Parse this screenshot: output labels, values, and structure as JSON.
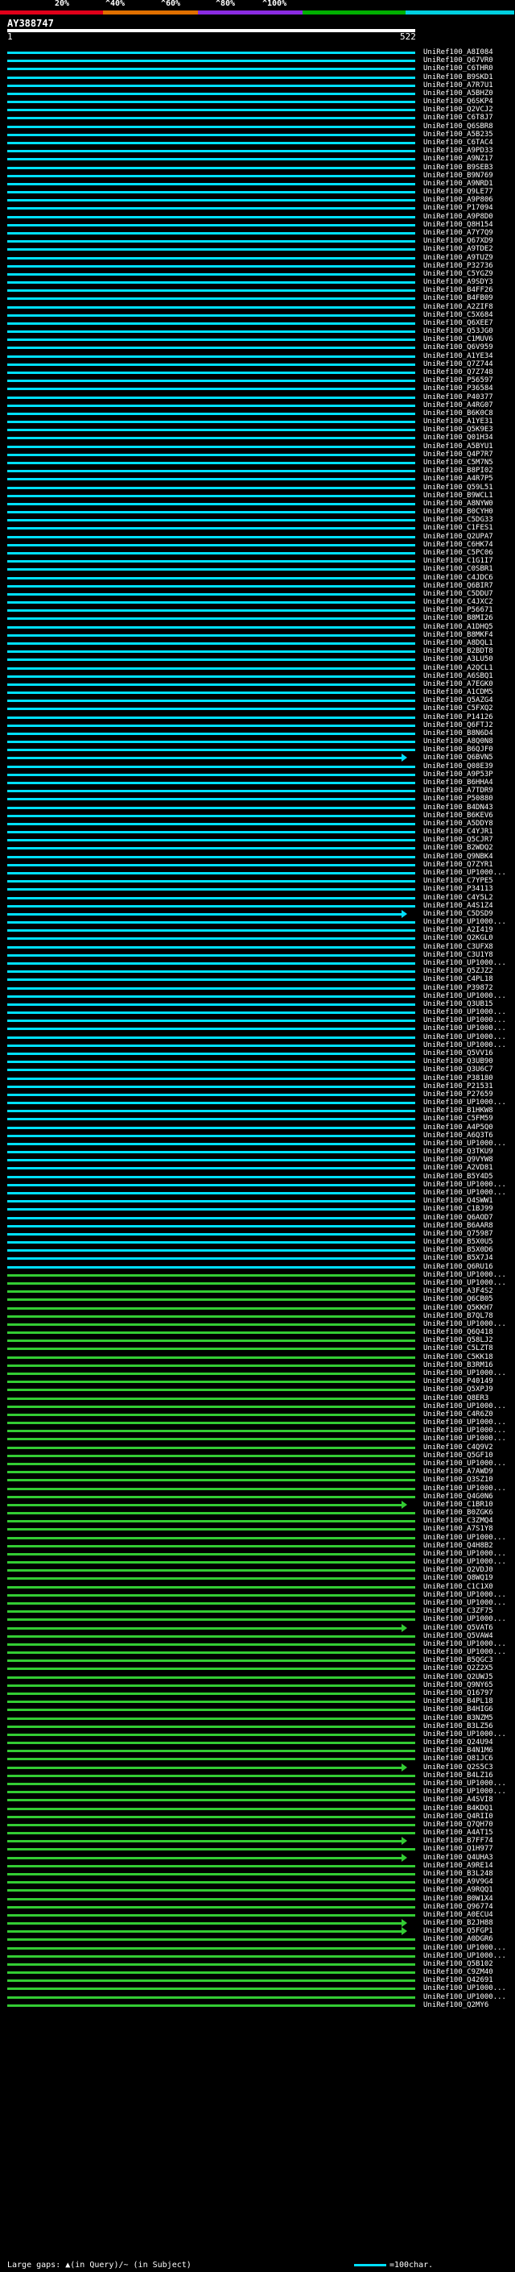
{
  "scale": {
    "labels": [
      "20%",
      "^40%",
      "^60%",
      "^80%",
      "^100%"
    ],
    "colors": [
      "#e0001a",
      "#e07000",
      "#8a2be2",
      "#00b000",
      "#00d0e0"
    ]
  },
  "query": {
    "name": "AY388747",
    "start": "1",
    "end": "522"
  },
  "hits": [
    {
      "name": "UniRef100_A8I084",
      "color": "#00e0ff"
    },
    {
      "name": "UniRef100_Q67VR0",
      "color": "#00e0ff"
    },
    {
      "name": "UniRef100_C6THR0",
      "color": "#00e0ff"
    },
    {
      "name": "UniRef100_B9SKD1",
      "color": "#00e0ff"
    },
    {
      "name": "UniRef100_A7R7U1",
      "color": "#00e0ff"
    },
    {
      "name": "UniRef100_A5BHZ0",
      "color": "#00e0ff"
    },
    {
      "name": "UniRef100_Q6SKP4",
      "color": "#00e0ff"
    },
    {
      "name": "UniRef100_Q2VCJ2",
      "color": "#00e0ff"
    },
    {
      "name": "UniRef100_C6T8J7",
      "color": "#00e0ff"
    },
    {
      "name": "UniRef100_Q6SBR8",
      "color": "#00e0ff"
    },
    {
      "name": "UniRef100_A5B235",
      "color": "#00e0ff"
    },
    {
      "name": "UniRef100_C6TAC4",
      "color": "#00e0ff"
    },
    {
      "name": "UniRef100_A9PD33",
      "color": "#00e0ff"
    },
    {
      "name": "UniRef100_A9NZ17",
      "color": "#00e0ff"
    },
    {
      "name": "UniRef100_B9SEB3",
      "color": "#00e0ff"
    },
    {
      "name": "UniRef100_B9N769",
      "color": "#00e0ff"
    },
    {
      "name": "UniRef100_A9NRD1",
      "color": "#00e0ff"
    },
    {
      "name": "UniRef100_Q9LE77",
      "color": "#00e0ff"
    },
    {
      "name": "UniRef100_A9P806",
      "color": "#00e0ff"
    },
    {
      "name": "UniRef100_P17094",
      "color": "#00e0ff"
    },
    {
      "name": "UniRef100_A9P8D0",
      "color": "#00e0ff"
    },
    {
      "name": "UniRef100_Q8H154",
      "color": "#00e0ff"
    },
    {
      "name": "UniRef100_A7Y7Q9",
      "color": "#00e0ff"
    },
    {
      "name": "UniRef100_Q67XD9",
      "color": "#00e0ff"
    },
    {
      "name": "UniRef100_A9TDE2",
      "color": "#00e0ff"
    },
    {
      "name": "UniRef100_A9TUZ9",
      "color": "#00e0ff"
    },
    {
      "name": "UniRef100_P32736",
      "color": "#00e0ff"
    },
    {
      "name": "UniRef100_C5YGZ9",
      "color": "#00e0ff"
    },
    {
      "name": "UniRef100_A9SDY3",
      "color": "#00e0ff"
    },
    {
      "name": "UniRef100_B4FF26",
      "color": "#00e0ff"
    },
    {
      "name": "UniRef100_B4FB09",
      "color": "#00e0ff"
    },
    {
      "name": "UniRef100_A2ZIF8",
      "color": "#00e0ff"
    },
    {
      "name": "UniRef100_C5X684",
      "color": "#00e0ff"
    },
    {
      "name": "UniRef100_Q6XEE7",
      "color": "#00e0ff"
    },
    {
      "name": "UniRef100_Q53JG0",
      "color": "#00e0ff"
    },
    {
      "name": "UniRef100_C1MUV6",
      "color": "#00e0ff"
    },
    {
      "name": "UniRef100_Q6V959",
      "color": "#00e0ff"
    },
    {
      "name": "UniRef100_A1YE34",
      "color": "#00e0ff"
    },
    {
      "name": "UniRef100_Q7Z744",
      "color": "#00e0ff"
    },
    {
      "name": "UniRef100_Q7Z748",
      "color": "#00e0ff"
    },
    {
      "name": "UniRef100_P56597",
      "color": "#00e0ff"
    },
    {
      "name": "UniRef100_P36584",
      "color": "#00e0ff"
    },
    {
      "name": "UniRef100_P40377",
      "color": "#00e0ff"
    },
    {
      "name": "UniRef100_A4RG07",
      "color": "#00e0ff"
    },
    {
      "name": "UniRef100_B6K0C8",
      "color": "#00e0ff"
    },
    {
      "name": "UniRef100_A1YE31",
      "color": "#00e0ff"
    },
    {
      "name": "UniRef100_Q5K9E3",
      "color": "#00e0ff"
    },
    {
      "name": "UniRef100_Q01H34",
      "color": "#00e0ff"
    },
    {
      "name": "UniRef100_A5BYU1",
      "color": "#00e0ff"
    },
    {
      "name": "UniRef100_Q4P7R7",
      "color": "#00e0ff"
    },
    {
      "name": "UniRef100_C5M7N5",
      "color": "#00e0ff"
    },
    {
      "name": "UniRef100_B8PI02",
      "color": "#00e0ff"
    },
    {
      "name": "UniRef100_A4R7P5",
      "color": "#00e0ff"
    },
    {
      "name": "UniRef100_Q59L51",
      "color": "#00e0ff"
    },
    {
      "name": "UniRef100_B9WCL1",
      "color": "#00e0ff"
    },
    {
      "name": "UniRef100_A8NYW0",
      "color": "#00e0ff"
    },
    {
      "name": "UniRef100_B0CYH0",
      "color": "#00e0ff"
    },
    {
      "name": "UniRef100_C5DG33",
      "color": "#00e0ff"
    },
    {
      "name": "UniRef100_C1FES1",
      "color": "#00e0ff"
    },
    {
      "name": "UniRef100_Q2UPA7",
      "color": "#00e0ff"
    },
    {
      "name": "UniRef100_C6HK74",
      "color": "#00e0ff"
    },
    {
      "name": "UniRef100_C5PC06",
      "color": "#00e0ff"
    },
    {
      "name": "UniRef100_C1G1I7",
      "color": "#00e0ff"
    },
    {
      "name": "UniRef100_C0SBR1",
      "color": "#00e0ff"
    },
    {
      "name": "UniRef100_C4JDC6",
      "color": "#00e0ff"
    },
    {
      "name": "UniRef100_Q6BIR7",
      "color": "#00e0ff"
    },
    {
      "name": "UniRef100_C5DDU7",
      "color": "#00e0ff"
    },
    {
      "name": "UniRef100_C4JXC2",
      "color": "#00e0ff"
    },
    {
      "name": "UniRef100_P56671",
      "color": "#00e0ff"
    },
    {
      "name": "UniRef100_B8MI26",
      "color": "#00e0ff"
    },
    {
      "name": "UniRef100_A1DHQ5",
      "color": "#00e0ff"
    },
    {
      "name": "UniRef100_B8MKF4",
      "color": "#00e0ff"
    },
    {
      "name": "UniRef100_A8DQL1",
      "color": "#00e0ff"
    },
    {
      "name": "UniRef100_B2BDT8",
      "color": "#00e0ff"
    },
    {
      "name": "UniRef100_A3LU50",
      "color": "#00e0ff"
    },
    {
      "name": "UniRef100_A2QCL1",
      "color": "#00e0ff"
    },
    {
      "name": "UniRef100_A6SBQ1",
      "color": "#00e0ff"
    },
    {
      "name": "UniRef100_A7EGK0",
      "color": "#00e0ff"
    },
    {
      "name": "UniRef100_A1CDM5",
      "color": "#00e0ff"
    },
    {
      "name": "UniRef100_Q5AZG4",
      "color": "#00e0ff"
    },
    {
      "name": "UniRef100_C5FXQ2",
      "color": "#00e0ff"
    },
    {
      "name": "UniRef100_P14126",
      "color": "#00e0ff"
    },
    {
      "name": "UniRef100_Q6FTJ2",
      "color": "#00e0ff"
    },
    {
      "name": "UniRef100_B8N6D4",
      "color": "#00e0ff"
    },
    {
      "name": "UniRef100_A8Q0N8",
      "color": "#00e0ff"
    },
    {
      "name": "UniRef100_B6QJF0",
      "color": "#00e0ff"
    },
    {
      "name": "UniRef100_Q6BVN5",
      "color": "#00e0ff",
      "arrow": true
    },
    {
      "name": "UniRef100_Q08E39",
      "color": "#00e0ff"
    },
    {
      "name": "UniRef100_A9P53P",
      "color": "#00e0ff"
    },
    {
      "name": "UniRef100_B6HHA4",
      "color": "#00e0ff"
    },
    {
      "name": "UniRef100_A7TDR9",
      "color": "#00e0ff"
    },
    {
      "name": "UniRef100_P50880",
      "color": "#00e0ff"
    },
    {
      "name": "UniRef100_B4DN43",
      "color": "#00e0ff"
    },
    {
      "name": "UniRef100_B6KEV6",
      "color": "#00e0ff"
    },
    {
      "name": "UniRef100_A5DDY8",
      "color": "#00e0ff"
    },
    {
      "name": "UniRef100_C4YJR1",
      "color": "#00e0ff"
    },
    {
      "name": "UniRef100_Q5CJR7",
      "color": "#00e0ff"
    },
    {
      "name": "UniRef100_B2WDQ2",
      "color": "#00e0ff"
    },
    {
      "name": "UniRef100_Q9NBK4",
      "color": "#00e0ff"
    },
    {
      "name": "UniRef100_Q7ZYR1",
      "color": "#00e0ff"
    },
    {
      "name": "UniRef100_UP1000...",
      "color": "#00e0ff"
    },
    {
      "name": "UniRef100_C7YPE5",
      "color": "#00e0ff"
    },
    {
      "name": "UniRef100_P34113",
      "color": "#00e0ff"
    },
    {
      "name": "UniRef100_C4Y5L2",
      "color": "#00e0ff"
    },
    {
      "name": "UniRef100_A4S1Z4",
      "color": "#00e0ff"
    },
    {
      "name": "UniRef100_C5DSD9",
      "color": "#00e0ff",
      "arrow": true
    },
    {
      "name": "UniRef100_UP1000...",
      "color": "#00e0ff"
    },
    {
      "name": "UniRef100_A2I419",
      "color": "#00e0ff"
    },
    {
      "name": "UniRef100_Q2KGL0",
      "color": "#00e0ff"
    },
    {
      "name": "UniRef100_C3UFX8",
      "color": "#00e0ff"
    },
    {
      "name": "UniRef100_C3U1Y8",
      "color": "#00e0ff"
    },
    {
      "name": "UniRef100_UP1000...",
      "color": "#00e0ff"
    },
    {
      "name": "UniRef100_Q5ZJZ2",
      "color": "#00e0ff"
    },
    {
      "name": "UniRef100_C4PL18",
      "color": "#00e0ff"
    },
    {
      "name": "UniRef100_P39872",
      "color": "#00e0ff"
    },
    {
      "name": "UniRef100_UP1000...",
      "color": "#00e0ff"
    },
    {
      "name": "UniRef100_Q3UB15",
      "color": "#00e0ff"
    },
    {
      "name": "UniRef100_UP1000...",
      "color": "#00e0ff"
    },
    {
      "name": "UniRef100_UP1000...",
      "color": "#00e0ff"
    },
    {
      "name": "UniRef100_UP1000...",
      "color": "#00e0ff"
    },
    {
      "name": "UniRef100_UP1000...",
      "color": "#00e0ff"
    },
    {
      "name": "UniRef100_UP1000...",
      "color": "#00e0ff"
    },
    {
      "name": "UniRef100_Q5VV16",
      "color": "#00e0ff"
    },
    {
      "name": "UniRef100_Q3UB90",
      "color": "#00e0ff"
    },
    {
      "name": "UniRef100_Q3U6C7",
      "color": "#00e0ff"
    },
    {
      "name": "UniRef100_P38180",
      "color": "#00e0ff"
    },
    {
      "name": "UniRef100_P21531",
      "color": "#00e0ff"
    },
    {
      "name": "UniRef100_P27659",
      "color": "#00e0ff"
    },
    {
      "name": "UniRef100_UP1000...",
      "color": "#00e0ff"
    },
    {
      "name": "UniRef100_B1HKW8",
      "color": "#00e0ff"
    },
    {
      "name": "UniRef100_C5FM59",
      "color": "#00e0ff"
    },
    {
      "name": "UniRef100_A4P5Q0",
      "color": "#00e0ff"
    },
    {
      "name": "UniRef100_A6Q3T6",
      "color": "#00e0ff"
    },
    {
      "name": "UniRef100_UP1000...",
      "color": "#00e0ff"
    },
    {
      "name": "UniRef100_Q3TKU9",
      "color": "#00e0ff"
    },
    {
      "name": "UniRef100_Q9VYW8",
      "color": "#00e0ff"
    },
    {
      "name": "UniRef100_A2VD81",
      "color": "#00e0ff"
    },
    {
      "name": "UniRef100_B5Y4D5",
      "color": "#00e0ff"
    },
    {
      "name": "UniRef100_UP1000...",
      "color": "#00e0ff"
    },
    {
      "name": "UniRef100_UP1000...",
      "color": "#00e0ff"
    },
    {
      "name": "UniRef100_Q4SWW1",
      "color": "#00e0ff"
    },
    {
      "name": "UniRef100_C1BJ99",
      "color": "#00e0ff"
    },
    {
      "name": "UniRef100_Q6AOD7",
      "color": "#00e0ff"
    },
    {
      "name": "UniRef100_B6AAR8",
      "color": "#00e0ff"
    },
    {
      "name": "UniRef100_Q75987",
      "color": "#00e0ff"
    },
    {
      "name": "UniRef100_B5X0U5",
      "color": "#00e0ff"
    },
    {
      "name": "UniRef100_B5X0D6",
      "color": "#00e0ff"
    },
    {
      "name": "UniRef100_B5X7J4",
      "color": "#00e0ff"
    },
    {
      "name": "UniRef100_Q6RU16",
      "color": "#00e0ff"
    },
    {
      "name": "UniRef100_UP1000...",
      "color": "#33cc33"
    },
    {
      "name": "UniRef100_UP1000...",
      "color": "#33cc33"
    },
    {
      "name": "UniRef100_A3F4S2",
      "color": "#33cc33"
    },
    {
      "name": "UniRef100_Q6CB05",
      "color": "#33cc33"
    },
    {
      "name": "UniRef100_Q5KKH7",
      "color": "#33cc33"
    },
    {
      "name": "UniRef100_B7QL78",
      "color": "#33cc33"
    },
    {
      "name": "UniRef100_UP1000...",
      "color": "#33cc33"
    },
    {
      "name": "UniRef100_Q6Q418",
      "color": "#33cc33"
    },
    {
      "name": "UniRef100_Q58LJ2",
      "color": "#33cc33"
    },
    {
      "name": "UniRef100_C5LZT8",
      "color": "#33cc33"
    },
    {
      "name": "UniRef100_C5KK18",
      "color": "#33cc33"
    },
    {
      "name": "UniRef100_B3RM16",
      "color": "#33cc33"
    },
    {
      "name": "UniRef100_UP1000...",
      "color": "#33cc33"
    },
    {
      "name": "UniRef100_P40149",
      "color": "#33cc33"
    },
    {
      "name": "UniRef100_Q5XPJ9",
      "color": "#33cc33"
    },
    {
      "name": "UniRef100_Q8ER3",
      "color": "#33cc33"
    },
    {
      "name": "UniRef100_UP1000...",
      "color": "#33cc33"
    },
    {
      "name": "UniRef100_C4R6Z0",
      "color": "#33cc33"
    },
    {
      "name": "UniRef100_UP1000...",
      "color": "#33cc33"
    },
    {
      "name": "UniRef100_UP1000...",
      "color": "#33cc33"
    },
    {
      "name": "UniRef100_UP1000...",
      "color": "#33cc33"
    },
    {
      "name": "UniRef100_C4Q9V2",
      "color": "#33cc33"
    },
    {
      "name": "UniRef100_Q5GF10",
      "color": "#33cc33"
    },
    {
      "name": "UniRef100_UP1000...",
      "color": "#33cc33"
    },
    {
      "name": "UniRef100_A7AWD9",
      "color": "#33cc33"
    },
    {
      "name": "UniRef100_Q3SZ10",
      "color": "#33cc33"
    },
    {
      "name": "UniRef100_UP1000...",
      "color": "#33cc33"
    },
    {
      "name": "UniRef100_Q4G0N6",
      "color": "#33cc33"
    },
    {
      "name": "UniRef100_C1BR10",
      "color": "#33cc33",
      "arrow": true
    },
    {
      "name": "UniRef100_B0ZGK6",
      "color": "#33cc33"
    },
    {
      "name": "UniRef100_C3ZMQ4",
      "color": "#33cc33"
    },
    {
      "name": "UniRef100_A7S1Y8",
      "color": "#33cc33"
    },
    {
      "name": "UniRef100_UP1000...",
      "color": "#33cc33"
    },
    {
      "name": "UniRef100_Q4H8B2",
      "color": "#33cc33"
    },
    {
      "name": "UniRef100_UP1000...",
      "color": "#33cc33"
    },
    {
      "name": "UniRef100_UP1000...",
      "color": "#33cc33"
    },
    {
      "name": "UniRef100_Q2VDJ0",
      "color": "#33cc33"
    },
    {
      "name": "UniRef100_Q8WQ19",
      "color": "#33cc33"
    },
    {
      "name": "UniRef100_C1C1X0",
      "color": "#33cc33"
    },
    {
      "name": "UniRef100_UP1000...",
      "color": "#33cc33"
    },
    {
      "name": "UniRef100_UP1000...",
      "color": "#33cc33"
    },
    {
      "name": "UniRef100_C3ZF75",
      "color": "#33cc33"
    },
    {
      "name": "UniRef100_UP1000...",
      "color": "#33cc33"
    },
    {
      "name": "UniRef100_Q5VAT6",
      "color": "#33cc33",
      "arrow": true
    },
    {
      "name": "UniRef100_Q5VAW4",
      "color": "#33cc33"
    },
    {
      "name": "UniRef100_UP1000...",
      "color": "#33cc33"
    },
    {
      "name": "UniRef100_UP1000...",
      "color": "#33cc33"
    },
    {
      "name": "UniRef100_B5QGC3",
      "color": "#33cc33"
    },
    {
      "name": "UniRef100_Q2Z2X5",
      "color": "#33cc33"
    },
    {
      "name": "UniRef100_Q2UWJ5",
      "color": "#33cc33"
    },
    {
      "name": "UniRef100_Q9NY65",
      "color": "#33cc33"
    },
    {
      "name": "UniRef100_Q16797",
      "color": "#33cc33"
    },
    {
      "name": "UniRef100_B4PL18",
      "color": "#33cc33"
    },
    {
      "name": "UniRef100_B4HIG6",
      "color": "#33cc33"
    },
    {
      "name": "UniRef100_B3NZM5",
      "color": "#33cc33"
    },
    {
      "name": "UniRef100_B3LZ56",
      "color": "#33cc33"
    },
    {
      "name": "UniRef100_UP1000...",
      "color": "#33cc33"
    },
    {
      "name": "UniRef100_Q24U94",
      "color": "#33cc33"
    },
    {
      "name": "UniRef100_B4N1M6",
      "color": "#33cc33"
    },
    {
      "name": "UniRef100_Q81JC6",
      "color": "#33cc33"
    },
    {
      "name": "UniRef100_Q2S5C3",
      "color": "#33cc33",
      "arrow": true
    },
    {
      "name": "UniRef100_B4LZ16",
      "color": "#33cc33"
    },
    {
      "name": "UniRef100_UP1000...",
      "color": "#33cc33"
    },
    {
      "name": "UniRef100_UP1000...",
      "color": "#33cc33"
    },
    {
      "name": "UniRef100_A4SVI8",
      "color": "#33cc33"
    },
    {
      "name": "UniRef100_B4KDQ1",
      "color": "#33cc33"
    },
    {
      "name": "UniRef100_Q4RII0",
      "color": "#33cc33"
    },
    {
      "name": "UniRef100_Q7QH70",
      "color": "#33cc33"
    },
    {
      "name": "UniRef100_A4AT15",
      "color": "#33cc33"
    },
    {
      "name": "UniRef100_B7FF74",
      "color": "#33cc33",
      "arrow": true
    },
    {
      "name": "UniRef100_Q1H977",
      "color": "#33cc33"
    },
    {
      "name": "UniRef100_Q4UHA3",
      "color": "#33cc33",
      "arrow": true
    },
    {
      "name": "UniRef100_A9RE14",
      "color": "#33cc33"
    },
    {
      "name": "UniRef100_B3L248",
      "color": "#33cc33"
    },
    {
      "name": "UniRef100_A9V9G4",
      "color": "#33cc33"
    },
    {
      "name": "UniRef100_A9RQQ1",
      "color": "#33cc33"
    },
    {
      "name": "UniRef100_B0W1X4",
      "color": "#33cc33"
    },
    {
      "name": "UniRef100_Q96774",
      "color": "#33cc33"
    },
    {
      "name": "UniRef100_A0ECU4",
      "color": "#33cc33"
    },
    {
      "name": "UniRef100_B2JH88",
      "color": "#33cc33",
      "arrow": true
    },
    {
      "name": "UniRef100_Q5FGP1",
      "color": "#33cc33",
      "arrow": true
    },
    {
      "name": "UniRef100_A0DGR6",
      "color": "#33cc33"
    },
    {
      "name": "UniRef100_UP1000...",
      "color": "#33cc33"
    },
    {
      "name": "UniRef100_UP1000...",
      "color": "#33cc33"
    },
    {
      "name": "UniRef100_Q5B102",
      "color": "#33cc33"
    },
    {
      "name": "UniRef100_C9ZM40",
      "color": "#33cc33"
    },
    {
      "name": "UniRef100_Q42691",
      "color": "#33cc33"
    },
    {
      "name": "UniRef100_UP1000...",
      "color": "#33cc33"
    },
    {
      "name": "UniRef100_UP1000...",
      "color": "#33cc33"
    },
    {
      "name": "UniRef100_Q2MY6",
      "color": "#33cc33"
    }
  ],
  "legend": {
    "left": "Large gaps: ▲(in Query)/~ (in Subject)",
    "right": "=100char."
  }
}
